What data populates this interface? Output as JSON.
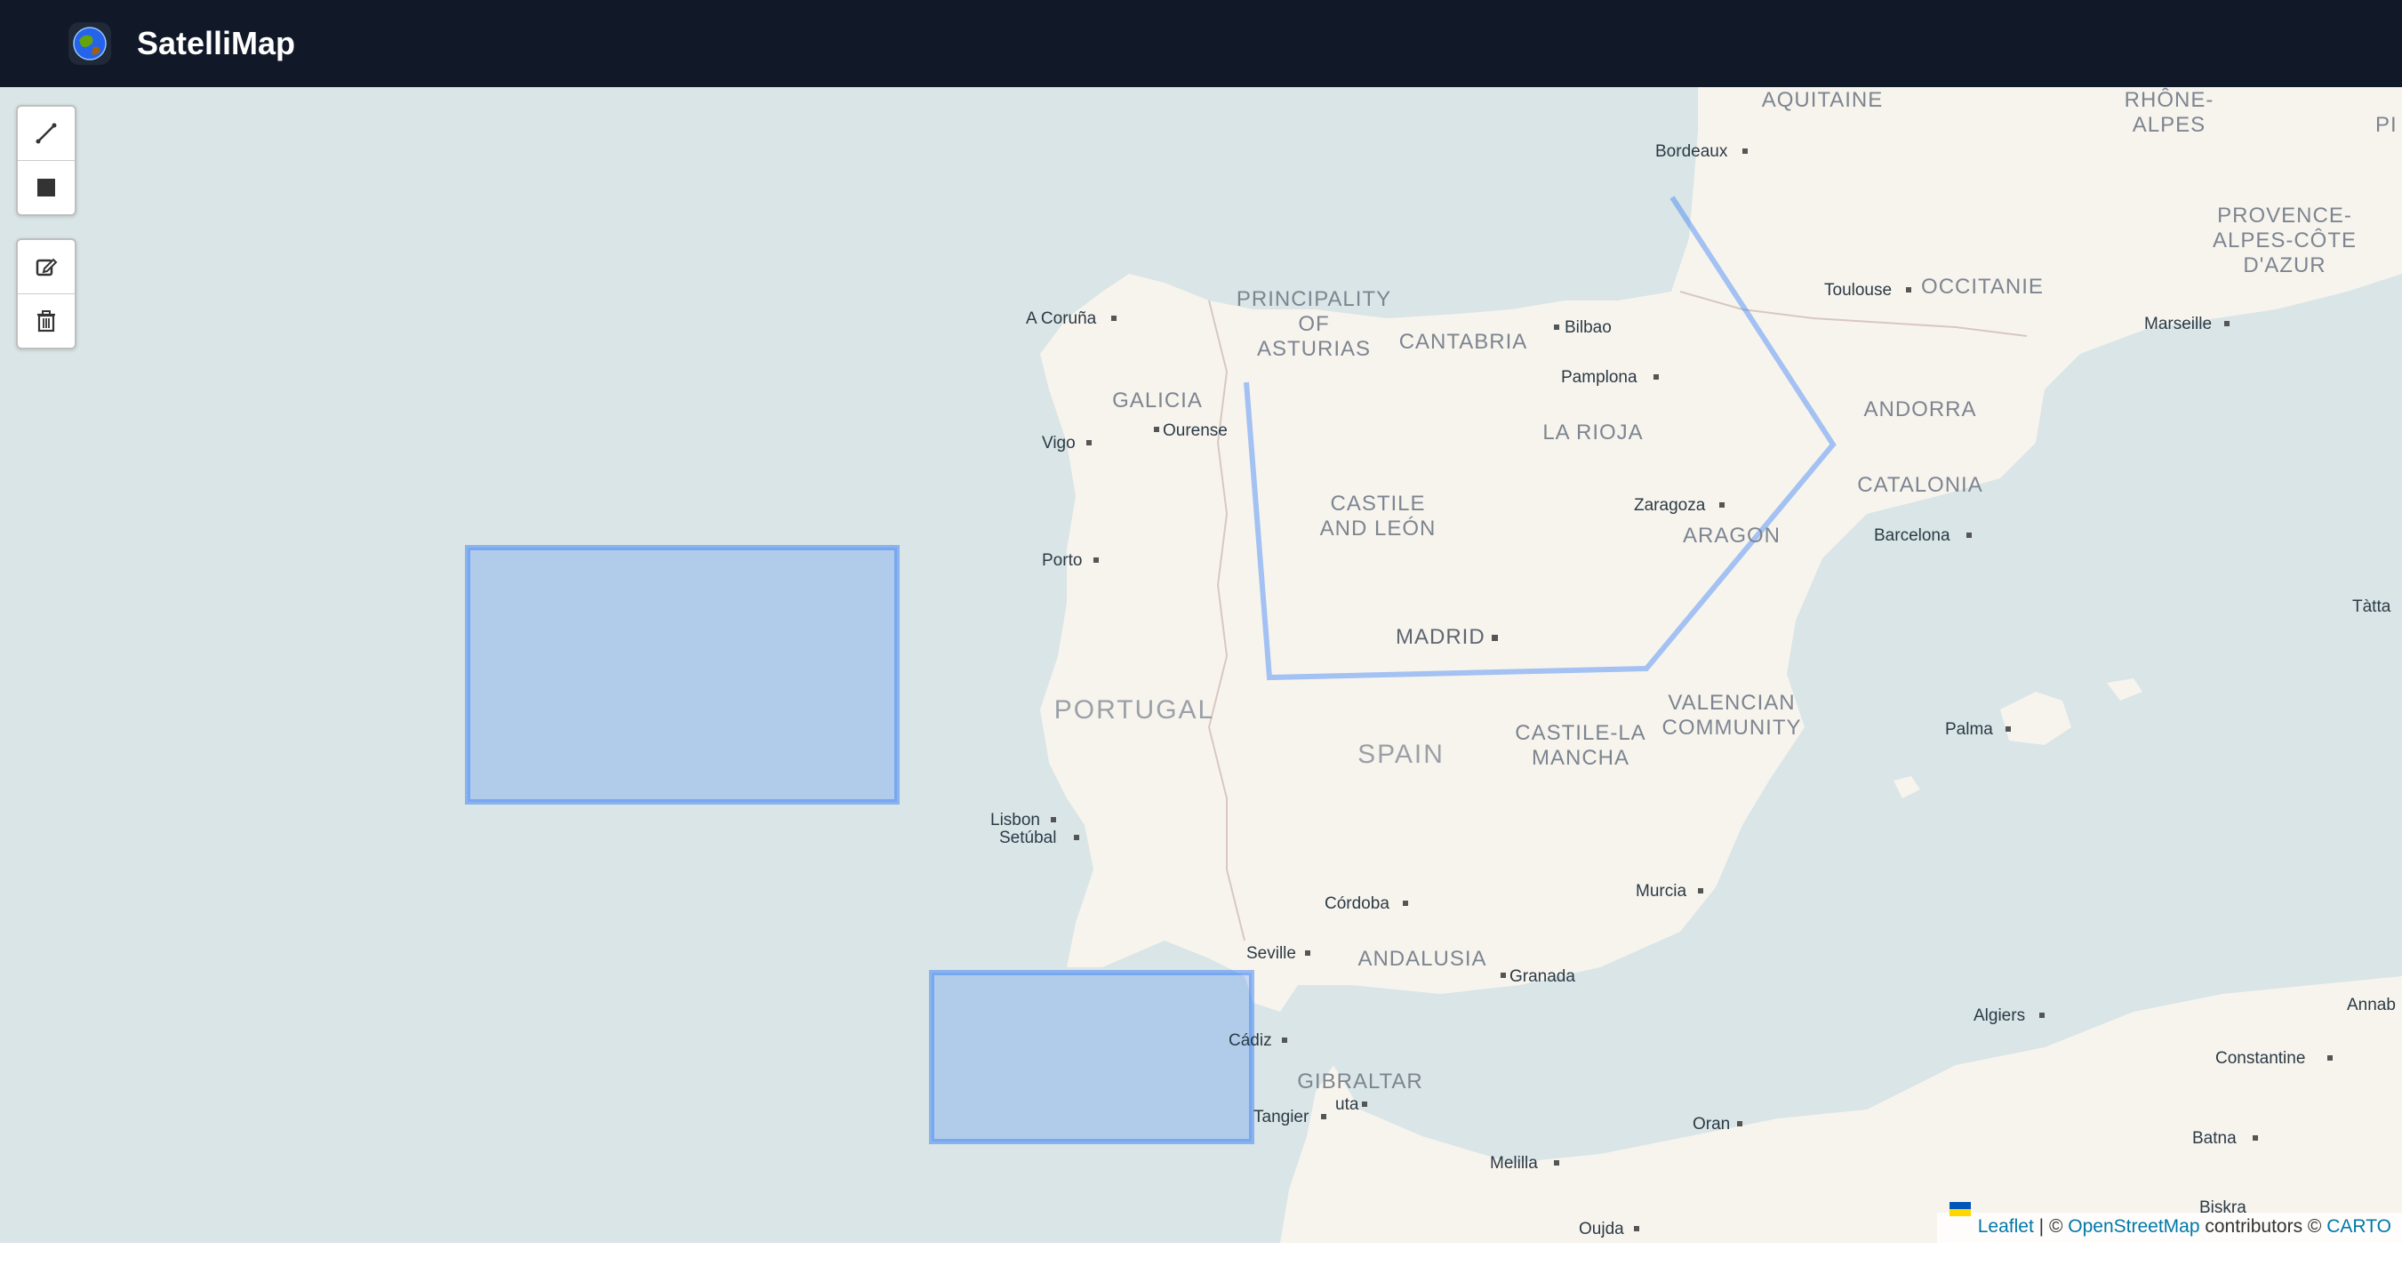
{
  "app": {
    "title": "SatelliMap"
  },
  "toolbar": {
    "draw": [
      {
        "name": "draw-polyline-button",
        "icon": "polyline-icon"
      },
      {
        "name": "draw-rectangle-button",
        "icon": "rectangle-icon"
      }
    ],
    "edit": [
      {
        "name": "edit-layers-button",
        "icon": "edit-icon"
      },
      {
        "name": "delete-layers-button",
        "icon": "trash-icon"
      }
    ]
  },
  "map": {
    "cities": {
      "bordeaux": "Bordeaux",
      "toulouse": "Toulouse",
      "marseille": "Marseille",
      "a_coruna": "A Coruña",
      "bilbao": "Bilbao",
      "pamplona": "Pamplona",
      "ourense": "Ourense",
      "vigo": "Vigo",
      "zaragoza": "Zaragoza",
      "barcelona": "Barcelona",
      "porto": "Porto",
      "madrid": "MADRID",
      "tatta": "Tàtta",
      "palma": "Palma",
      "lisbon": "Lisbon",
      "setubal": "Setúbal",
      "cordoba": "Córdoba",
      "murcia": "Murcia",
      "seville": "Seville",
      "granada": "Granada",
      "algiers": "Algiers",
      "cadiz": "Cádiz",
      "constantine": "Constantine",
      "annaba": "Annab",
      "ceuta": "uta",
      "tangier": "Tangier",
      "oran": "Oran",
      "batna": "Batna",
      "melilla": "Melilla",
      "biskra": "Biskra",
      "oujda": "Oujda"
    },
    "regions": {
      "aquitaine": "AQUITAINE",
      "rhone_1": "RHÔNE-",
      "rhone_2": "ALPES",
      "pi": "PI",
      "provence_1": "PROVENCE-",
      "provence_2": "ALPES-CÔTE",
      "provence_3": "D'AZUR",
      "occitanie": "OCCITANIE",
      "asturias_1": "PRINCIPALITY",
      "asturias_2": "OF",
      "asturias_3": "ASTURIAS",
      "cantabria": "CANTABRIA",
      "galicia": "GALICIA",
      "andorra": "ANDORRA",
      "la_rioja": "LA RIOJA",
      "catalonia": "CATALONIA",
      "castile_leon_1": "CASTILE",
      "castile_leon_2": "AND LEÓN",
      "aragon": "ARAGON",
      "valencian_1": "VALENCIAN",
      "valencian_2": "COMMUNITY",
      "castile_mancha_1": "CASTILE-LA",
      "castile_mancha_2": "MANCHA",
      "andalusia": "ANDALUSIA",
      "gibraltar": "GIBRALTAR"
    },
    "countries": {
      "portugal": "PORTUGAL",
      "spain": "SPAIN"
    }
  },
  "attribution": {
    "leaflet": "Leaflet",
    "sep": "| ©",
    "osm": "OpenStreetMap",
    "contributors": "contributors ©",
    "carto": "CARTO"
  },
  "colors": {
    "header_bg": "#111827",
    "water": "#d9e5e6",
    "land": "#f7f4ee",
    "drawn_shape": "#3b82f6"
  }
}
